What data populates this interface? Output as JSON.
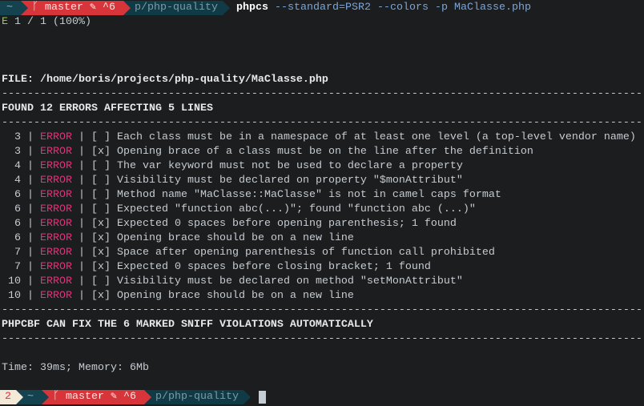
{
  "prompt_top": {
    "home": "~",
    "git_icon": "ᚴ",
    "branch": "master",
    "dirty_icon": "✎",
    "ahead": "^6",
    "dir": "p/php-quality",
    "command": "phpcs",
    "args": " --standard=PSR2 --colors -p MaClasse.php"
  },
  "progress": {
    "marker": "E",
    "text": " 1 / 1 (100%)"
  },
  "file_line": "FILE: /home/boris/projects/php-quality/MaClasse.php",
  "separator": "----------------------------------------------------------------------------------------------------",
  "summary": "FOUND 12 ERRORS AFFECTING 5 LINES",
  "errors": [
    {
      "line": "3",
      "type": "ERROR",
      "fixable": "[ ]",
      "message": "Each class must be in a namespace of at least one level (a top-level vendor name)"
    },
    {
      "line": "3",
      "type": "ERROR",
      "fixable": "[x]",
      "message": "Opening brace of a class must be on the line after the definition"
    },
    {
      "line": "4",
      "type": "ERROR",
      "fixable": "[ ]",
      "message": "The var keyword must not be used to declare a property"
    },
    {
      "line": "4",
      "type": "ERROR",
      "fixable": "[ ]",
      "message": "Visibility must be declared on property \"$monAttribut\""
    },
    {
      "line": "6",
      "type": "ERROR",
      "fixable": "[ ]",
      "message": "Method name \"MaClasse::MaClasse\" is not in camel caps format"
    },
    {
      "line": "6",
      "type": "ERROR",
      "fixable": "[ ]",
      "message": "Expected \"function abc(...)\"; found \"function abc (...)\""
    },
    {
      "line": "6",
      "type": "ERROR",
      "fixable": "[x]",
      "message": "Expected 0 spaces before opening parenthesis; 1 found"
    },
    {
      "line": "6",
      "type": "ERROR",
      "fixable": "[x]",
      "message": "Opening brace should be on a new line"
    },
    {
      "line": "7",
      "type": "ERROR",
      "fixable": "[x]",
      "message": "Space after opening parenthesis of function call prohibited"
    },
    {
      "line": "7",
      "type": "ERROR",
      "fixable": "[x]",
      "message": "Expected 0 spaces before closing bracket; 1 found"
    },
    {
      "line": "10",
      "type": "ERROR",
      "fixable": "[ ]",
      "message": "Visibility must be declared on method \"setMonAttribut\""
    },
    {
      "line": "10",
      "type": "ERROR",
      "fixable": "[x]",
      "message": "Opening brace should be on a new line"
    }
  ],
  "phpcbf": "PHPCBF CAN FIX THE 6 MARKED SNIFF VIOLATIONS AUTOMATICALLY",
  "timing": "Time: 39ms; Memory: 6Mb",
  "prompt_bottom": {
    "status": "2",
    "home": "~",
    "git_icon": "ᚴ",
    "branch": "master",
    "dirty_icon": "✎",
    "ahead": "^6",
    "dir": "p/php-quality"
  }
}
